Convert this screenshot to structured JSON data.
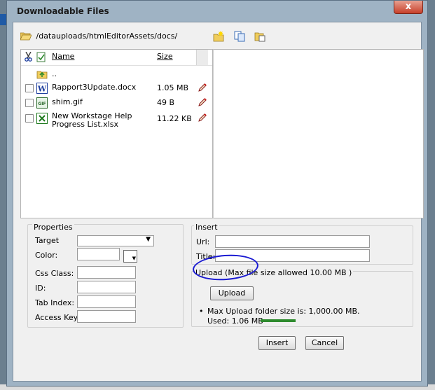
{
  "window": {
    "title": "Downloadable Files",
    "close_label": "x"
  },
  "path": {
    "current": "/datauploads/htmlEditorAssets/docs/"
  },
  "file_list": {
    "headers": {
      "name": "Name",
      "size": "Size"
    },
    "parent": "..",
    "files": [
      {
        "name": "Rapport3Update.docx",
        "size": "1.05 MB",
        "type": "word"
      },
      {
        "name": "shim.gif",
        "size": "49 B",
        "type": "gif"
      },
      {
        "name": "New Workstage Help Progress List.xlsx",
        "size": "11.22 KB",
        "type": "excel"
      }
    ]
  },
  "properties": {
    "legend": "Properties",
    "target_label": "Target",
    "color_label": "Color:",
    "css_class_label": "Css Class:",
    "id_label": "ID:",
    "tab_index_label": "Tab Index:",
    "access_key_label": "Access Key:"
  },
  "insert_panel": {
    "legend": "Insert",
    "url_label": "Url:",
    "title_label": "Title:"
  },
  "upload": {
    "legend": "Upload (Max file size allowed 10.00 MB )",
    "button_label": "Upload",
    "max_folder_text": "Max Upload folder size is: 1,000.00 MB.",
    "used_text": "Used: 1.06 MB",
    "used_fraction": 0.00106
  },
  "buttons": {
    "insert": "Insert",
    "cancel": "Cancel"
  },
  "colors": {
    "annotation": "#1a1ad2",
    "progress": "#2e8b2e",
    "close": "#c7402a"
  }
}
